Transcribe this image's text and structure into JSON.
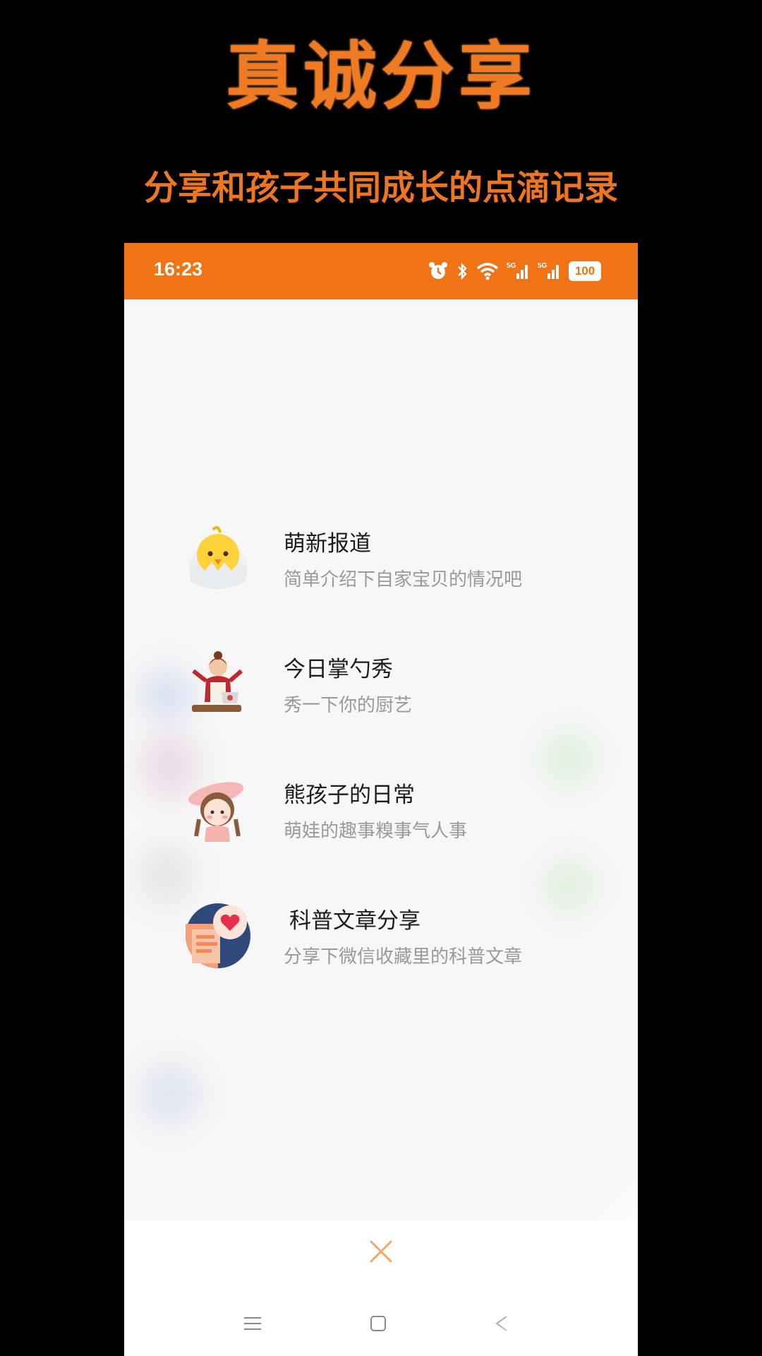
{
  "promo": {
    "title": "真诚分享",
    "subtitle": "分享和孩子共同成长的点滴记录"
  },
  "status_bar": {
    "time": "16:23",
    "battery": "100",
    "signal_label": "5G",
    "icons": [
      "alarm-icon",
      "bluetooth-icon",
      "wifi-icon",
      "signal-5g-icon",
      "signal-5g-icon",
      "battery-icon"
    ]
  },
  "menu": {
    "items": [
      {
        "title": "萌新报道",
        "desc": "简单介绍下自家宝贝的情况吧",
        "icon": "chick-icon"
      },
      {
        "title": "今日掌勺秀",
        "desc": "秀一下你的厨艺",
        "icon": "chef-icon"
      },
      {
        "title": "熊孩子的日常",
        "desc": "萌娃的趣事糗事气人事",
        "icon": "girl-icon"
      },
      {
        "title": "科普文章分享",
        "desc": "分享下微信收藏里的科普文章",
        "icon": "article-heart-icon"
      }
    ]
  },
  "colors": {
    "brand_orange": "#f07316",
    "promo_orange": "#f07a22",
    "text_primary": "#1c1c1c",
    "text_secondary": "#9a9a9a",
    "close_orange": "#f5a86a"
  }
}
